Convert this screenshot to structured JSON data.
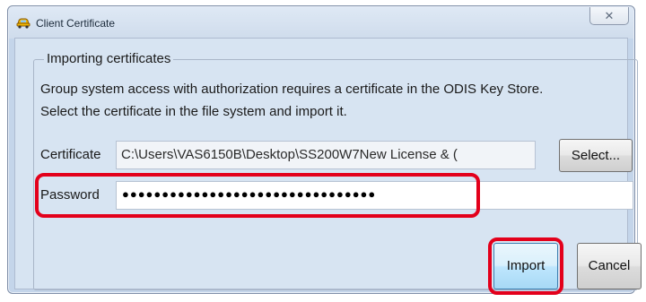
{
  "window": {
    "title": "Client Certificate",
    "close_symbol": "✕",
    "icon": "car-diagnostics-icon"
  },
  "group": {
    "title": "Importing certificates",
    "description_line1": "Group system access with authorization requires a certificate in the ODIS Key Store.",
    "description_line2": "Select the certificate in the file system and import it."
  },
  "certificate": {
    "label": "Certificate",
    "value": "C:\\Users\\VAS6150B\\Desktop\\SS200W7New License & (",
    "select_label": "Select..."
  },
  "password": {
    "label": "Password",
    "masked_value": "●●●●●●●●●●●●●●●●●●●●●●●●●●●●●●●●"
  },
  "buttons": {
    "import_label": "Import",
    "cancel_label": "Cancel"
  },
  "colors": {
    "highlight": "#e3001b",
    "dialog_background": "#d7e4f2",
    "default_button_border": "#3c7fb1"
  }
}
